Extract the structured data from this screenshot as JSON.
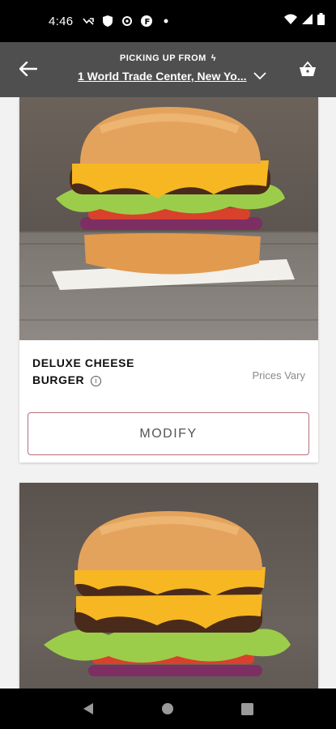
{
  "status_bar": {
    "time": "4:46"
  },
  "header": {
    "pickup_label": "PICKING UP FROM",
    "location": "1 World Trade Center, New Yo..."
  },
  "items": [
    {
      "name_line1": "DELUXE CHEESE",
      "name_line2": "BURGER",
      "info": "i",
      "price": "Prices Vary",
      "modify_label": "MODIFY"
    }
  ],
  "colors": {
    "app_bar": "#4f4f4f",
    "modify_border": "#b5707a"
  }
}
